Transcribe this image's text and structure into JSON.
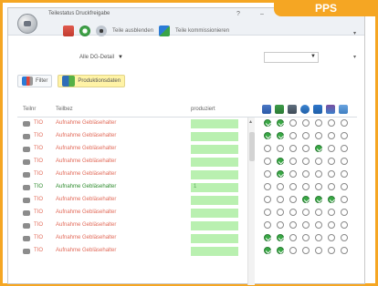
{
  "badge": "PPS",
  "window": {
    "title": "Teilestatus Druckfreigabe",
    "help": "?",
    "minimize": "–"
  },
  "toolbar": {
    "items": [
      {
        "name": "people-icon",
        "label": ""
      },
      {
        "name": "refresh-icon",
        "label": ""
      },
      {
        "name": "view-icon",
        "label": "Teile ausblenden"
      },
      {
        "name": "customize-icon",
        "label": "Teile kommissionieren"
      }
    ]
  },
  "filters": {
    "combo_label": "Alle DG-Detail",
    "small_box_value": ""
  },
  "actions": {
    "filter_label": "Filter",
    "production_label": "Produktionsdaten"
  },
  "grid": {
    "headers": [
      "Teilnr",
      "Teilbez",
      "produziert"
    ],
    "header_icons": [
      "icon-1",
      "icon-2",
      "icon-3",
      "icon-4",
      "icon-5",
      "icon-6",
      "icon-7"
    ],
    "rows": [
      {
        "c1": "TIO",
        "c2": "Aufnahme Gebläsehalter",
        "c1color": "red",
        "c2color": "red",
        "n": "",
        "s": [
          1,
          1,
          0,
          0,
          0,
          0,
          0
        ]
      },
      {
        "c1": "TIO",
        "c2": "Aufnahme Gebläsehalter",
        "c1color": "red",
        "c2color": "red",
        "n": "",
        "s": [
          1,
          1,
          0,
          0,
          0,
          0,
          0
        ]
      },
      {
        "c1": "TIO",
        "c2": "Aufnahme Gebläsehalter",
        "c1color": "red",
        "c2color": "red",
        "n": "",
        "s": [
          0,
          0,
          0,
          0,
          1,
          0,
          0
        ]
      },
      {
        "c1": "TIO",
        "c2": "Aufnahme Gebläsehalter",
        "c1color": "red",
        "c2color": "red",
        "n": "",
        "s": [
          0,
          1,
          0,
          0,
          0,
          0,
          0
        ]
      },
      {
        "c1": "TIO",
        "c2": "Aufnahme Gebläsehalter",
        "c1color": "red",
        "c2color": "red",
        "n": "",
        "s": [
          0,
          1,
          0,
          0,
          0,
          0,
          0
        ]
      },
      {
        "c1": "TIO",
        "c2": "Aufnahme Gebläsehalter",
        "c1color": "green",
        "c2color": "green",
        "n": "1",
        "s": [
          0,
          0,
          0,
          0,
          0,
          0,
          0
        ]
      },
      {
        "c1": "TIO",
        "c2": "Aufnahme Gebläsehalter",
        "c1color": "red",
        "c2color": "red",
        "n": "",
        "s": [
          0,
          0,
          0,
          1,
          1,
          1,
          0
        ]
      },
      {
        "c1": "TIO",
        "c2": "Aufnahme Gebläsehalter",
        "c1color": "red",
        "c2color": "red",
        "n": "",
        "s": [
          0,
          0,
          0,
          0,
          0,
          0,
          0
        ]
      },
      {
        "c1": "TIO",
        "c2": "Aufnahme Gebläsehalter",
        "c1color": "red",
        "c2color": "red",
        "n": "",
        "s": [
          0,
          0,
          0,
          0,
          0,
          0,
          0
        ]
      },
      {
        "c1": "TIO",
        "c2": "Aufnahme Gebläsehalter",
        "c1color": "red",
        "c2color": "red",
        "n": "",
        "s": [
          1,
          1,
          0,
          0,
          0,
          0,
          0
        ]
      },
      {
        "c1": "TIO",
        "c2": "Aufnahme Gebläsehalter",
        "c1color": "red",
        "c2color": "red",
        "n": "",
        "s": [
          1,
          1,
          0,
          0,
          0,
          0,
          0
        ]
      }
    ]
  }
}
